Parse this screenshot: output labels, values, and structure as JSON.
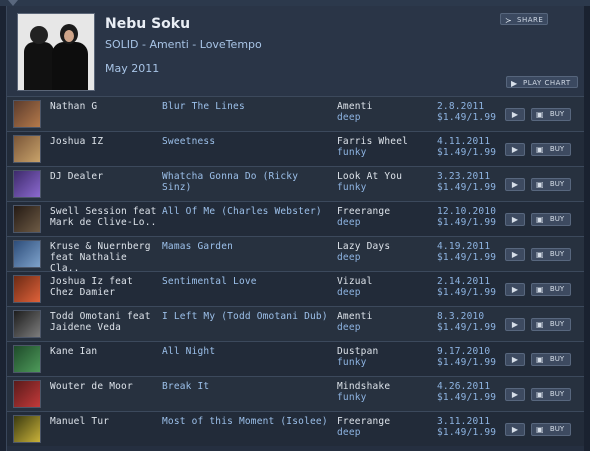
{
  "release": {
    "artist": "Nebu Soku",
    "subtitle": "SOLID - Amenti - LoveTempo",
    "date": "May 2011",
    "share_label": "SHARE",
    "play_chart_label": "PLAY CHART"
  },
  "tracks": [
    {
      "artist": "Nathan G",
      "title": "Blur The Lines",
      "label": "Amenti",
      "genre": "deep",
      "date": "2.8.2011",
      "price": "$1.49/1.99",
      "buy": "BUY",
      "thumb": [
        "#5b3b2c",
        "#b57a4b"
      ]
    },
    {
      "artist": "Joshua IZ",
      "title": "Sweetness",
      "label": "Farris Wheel",
      "genre": "funky",
      "date": "4.11.2011",
      "price": "$1.49/1.99",
      "buy": "BUY",
      "thumb": [
        "#7a5638",
        "#c9a36b"
      ]
    },
    {
      "artist": "DJ Dealer",
      "title": "Whatcha Gonna Do (Ricky Sinz)",
      "label": "Look At You",
      "genre": "funky",
      "date": "3.23.2011",
      "price": "$1.49/1.99",
      "buy": "BUY",
      "thumb": [
        "#3d2a6b",
        "#8c6ad0"
      ]
    },
    {
      "artist": "Swell Session feat Mark de Clive-Lo..",
      "title": "All Of Me (Charles Webster)",
      "label": "Freerange",
      "genre": "deep",
      "date": "12.10.2010",
      "price": "$1.49/1.99",
      "buy": "BUY",
      "thumb": [
        "#241a14",
        "#6e5b45"
      ]
    },
    {
      "artist": "Kruse & Nuernberg feat Nathalie Cla..",
      "title": "Mamas Garden",
      "label": "Lazy Days",
      "genre": "deep",
      "date": "4.19.2011",
      "price": "$1.49/1.99",
      "buy": "BUY",
      "thumb": [
        "#2d4d7a",
        "#7fa3cc"
      ]
    },
    {
      "artist": "Joshua Iz feat Chez Damier",
      "title": "Sentimental Love",
      "label": "Vizual",
      "genre": "deep",
      "date": "2.14.2011",
      "price": "$1.49/1.99",
      "buy": "BUY",
      "thumb": [
        "#6b2a14",
        "#e0623a"
      ]
    },
    {
      "artist": "Todd Omotani feat Jaidene Veda",
      "title": "I Left My (Todd Omotani Dub)",
      "label": "Amenti",
      "genre": "deep",
      "date": "8.3.2010",
      "price": "$1.49/1.99",
      "buy": "BUY",
      "thumb": [
        "#1d1d1d",
        "#7d7d7d"
      ]
    },
    {
      "artist": "Kane Ian",
      "title": "All Night",
      "label": "Dustpan",
      "genre": "funky",
      "date": "9.17.2010",
      "price": "$1.49/1.99",
      "buy": "BUY",
      "thumb": [
        "#1e4a2a",
        "#4e9b5a"
      ]
    },
    {
      "artist": "Wouter de Moor",
      "title": "Break It",
      "label": "Mindshake",
      "genre": "funky",
      "date": "4.26.2011",
      "price": "$1.49/1.99",
      "buy": "BUY",
      "thumb": [
        "#5a1a1a",
        "#c33a3a"
      ]
    },
    {
      "artist": "Manuel Tur",
      "title": "Most of this Moment (Isolee)",
      "label": "Freerange",
      "genre": "deep",
      "date": "3.11.2011",
      "price": "$1.49/1.99",
      "buy": "BUY",
      "thumb": [
        "#3a3a10",
        "#c9b23a"
      ]
    }
  ]
}
